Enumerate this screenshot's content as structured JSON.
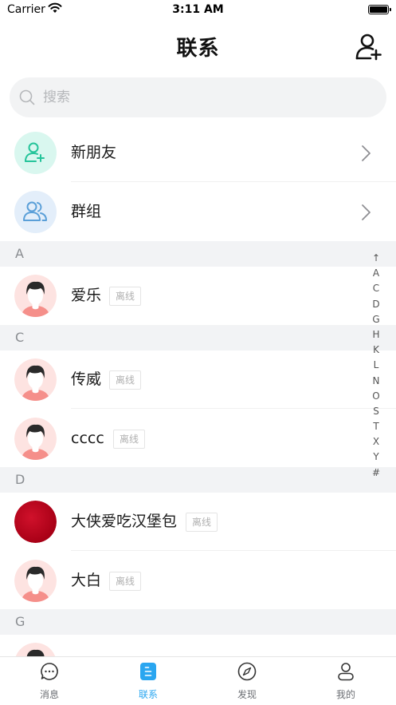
{
  "status_bar": {
    "carrier": "Carrier",
    "time": "3:11 AM"
  },
  "header": {
    "title": "联系"
  },
  "search": {
    "placeholder": "搜索"
  },
  "entries": [
    {
      "label": "新朋友",
      "icon": "add-user-icon"
    },
    {
      "label": "群组",
      "icon": "group-icon"
    }
  ],
  "sections": [
    {
      "letter": "A",
      "contacts": [
        {
          "name": "爱乐",
          "status": "离线"
        }
      ]
    },
    {
      "letter": "C",
      "contacts": [
        {
          "name": "传威",
          "status": "离线"
        },
        {
          "name": "cccc",
          "status": "离线"
        }
      ]
    },
    {
      "letter": "D",
      "contacts": [
        {
          "name": "大侠爱吃汉堡包",
          "status": "离线"
        },
        {
          "name": "大白",
          "status": "离线"
        }
      ]
    },
    {
      "letter": "G",
      "contacts": []
    }
  ],
  "index_letters": [
    "↑",
    "A",
    "C",
    "D",
    "G",
    "H",
    "K",
    "L",
    "N",
    "O",
    "S",
    "T",
    "X",
    "Y",
    "#"
  ],
  "tabs": [
    {
      "label": "消息",
      "icon": "chat-bubble-icon",
      "active": false
    },
    {
      "label": "联系",
      "icon": "contacts-book-icon",
      "active": true
    },
    {
      "label": "发现",
      "icon": "compass-icon",
      "active": false
    },
    {
      "label": "我的",
      "icon": "person-icon",
      "active": false
    }
  ],
  "colors": {
    "accent": "#2aa6f0",
    "new_friend_icon": "#25c49a",
    "group_icon": "#5a9fd8",
    "section_bg": "#f2f3f5"
  }
}
